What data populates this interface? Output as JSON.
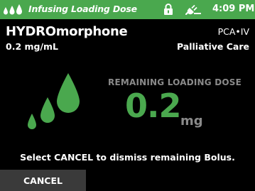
{
  "status_bar": {
    "background_color": "#4aa84e",
    "status_text": "Infusing Loading Dose",
    "time": "4:09 PM",
    "icons": [
      "drops-icon",
      "lock-icon",
      "plug-icon"
    ]
  },
  "drug": {
    "name": "HYDROmorphone",
    "concentration": "0.2 mg/mL",
    "mode": "PCA•IV",
    "care_area": "Palliative Care"
  },
  "dose": {
    "label": "REMAINING LOADING DOSE",
    "value": "0.2",
    "unit": "mg",
    "value_color": "#4aa84e"
  },
  "message": "Select CANCEL to dismiss remaining Bolus.",
  "buttons": {
    "cancel_label": "CANCEL"
  }
}
